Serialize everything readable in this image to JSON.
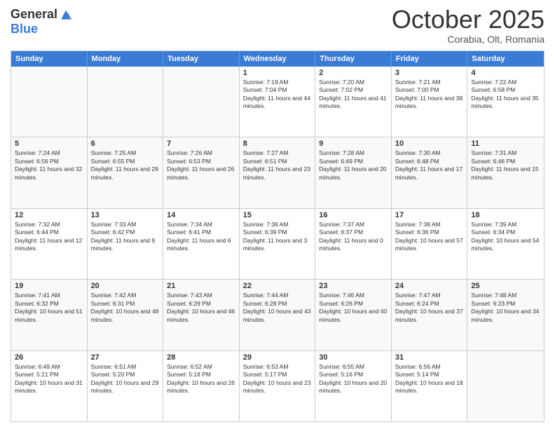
{
  "header": {
    "logo_general": "General",
    "logo_blue": "Blue",
    "month_title": "October 2025",
    "location": "Corabia, Olt, Romania"
  },
  "calendar": {
    "days_of_week": [
      "Sunday",
      "Monday",
      "Tuesday",
      "Wednesday",
      "Thursday",
      "Friday",
      "Saturday"
    ],
    "rows": [
      [
        {
          "day": "",
          "text": "",
          "empty": true
        },
        {
          "day": "",
          "text": "",
          "empty": true
        },
        {
          "day": "",
          "text": "",
          "empty": true
        },
        {
          "day": "1",
          "text": "Sunrise: 7:19 AM\nSunset: 7:04 PM\nDaylight: 11 hours and 44 minutes."
        },
        {
          "day": "2",
          "text": "Sunrise: 7:20 AM\nSunset: 7:02 PM\nDaylight: 11 hours and 41 minutes."
        },
        {
          "day": "3",
          "text": "Sunrise: 7:21 AM\nSunset: 7:00 PM\nDaylight: 11 hours and 38 minutes."
        },
        {
          "day": "4",
          "text": "Sunrise: 7:22 AM\nSunset: 6:58 PM\nDaylight: 11 hours and 35 minutes."
        }
      ],
      [
        {
          "day": "5",
          "text": "Sunrise: 7:24 AM\nSunset: 6:56 PM\nDaylight: 11 hours and 32 minutes."
        },
        {
          "day": "6",
          "text": "Sunrise: 7:25 AM\nSunset: 6:55 PM\nDaylight: 11 hours and 29 minutes."
        },
        {
          "day": "7",
          "text": "Sunrise: 7:26 AM\nSunset: 6:53 PM\nDaylight: 11 hours and 26 minutes."
        },
        {
          "day": "8",
          "text": "Sunrise: 7:27 AM\nSunset: 6:51 PM\nDaylight: 11 hours and 23 minutes."
        },
        {
          "day": "9",
          "text": "Sunrise: 7:28 AM\nSunset: 6:49 PM\nDaylight: 11 hours and 20 minutes."
        },
        {
          "day": "10",
          "text": "Sunrise: 7:30 AM\nSunset: 6:48 PM\nDaylight: 11 hours and 17 minutes."
        },
        {
          "day": "11",
          "text": "Sunrise: 7:31 AM\nSunset: 6:46 PM\nDaylight: 11 hours and 15 minutes."
        }
      ],
      [
        {
          "day": "12",
          "text": "Sunrise: 7:32 AM\nSunset: 6:44 PM\nDaylight: 11 hours and 12 minutes."
        },
        {
          "day": "13",
          "text": "Sunrise: 7:33 AM\nSunset: 6:42 PM\nDaylight: 11 hours and 9 minutes."
        },
        {
          "day": "14",
          "text": "Sunrise: 7:34 AM\nSunset: 6:41 PM\nDaylight: 11 hours and 6 minutes."
        },
        {
          "day": "15",
          "text": "Sunrise: 7:36 AM\nSunset: 6:39 PM\nDaylight: 11 hours and 3 minutes."
        },
        {
          "day": "16",
          "text": "Sunrise: 7:37 AM\nSunset: 6:37 PM\nDaylight: 11 hours and 0 minutes."
        },
        {
          "day": "17",
          "text": "Sunrise: 7:38 AM\nSunset: 6:36 PM\nDaylight: 10 hours and 57 minutes."
        },
        {
          "day": "18",
          "text": "Sunrise: 7:39 AM\nSunset: 6:34 PM\nDaylight: 10 hours and 54 minutes."
        }
      ],
      [
        {
          "day": "19",
          "text": "Sunrise: 7:41 AM\nSunset: 6:32 PM\nDaylight: 10 hours and 51 minutes."
        },
        {
          "day": "20",
          "text": "Sunrise: 7:42 AM\nSunset: 6:31 PM\nDaylight: 10 hours and 48 minutes."
        },
        {
          "day": "21",
          "text": "Sunrise: 7:43 AM\nSunset: 6:29 PM\nDaylight: 10 hours and 46 minutes."
        },
        {
          "day": "22",
          "text": "Sunrise: 7:44 AM\nSunset: 6:28 PM\nDaylight: 10 hours and 43 minutes."
        },
        {
          "day": "23",
          "text": "Sunrise: 7:46 AM\nSunset: 6:26 PM\nDaylight: 10 hours and 40 minutes."
        },
        {
          "day": "24",
          "text": "Sunrise: 7:47 AM\nSunset: 6:24 PM\nDaylight: 10 hours and 37 minutes."
        },
        {
          "day": "25",
          "text": "Sunrise: 7:48 AM\nSunset: 6:23 PM\nDaylight: 10 hours and 34 minutes."
        }
      ],
      [
        {
          "day": "26",
          "text": "Sunrise: 6:49 AM\nSunset: 5:21 PM\nDaylight: 10 hours and 31 minutes."
        },
        {
          "day": "27",
          "text": "Sunrise: 6:51 AM\nSunset: 5:20 PM\nDaylight: 10 hours and 29 minutes."
        },
        {
          "day": "28",
          "text": "Sunrise: 6:52 AM\nSunset: 5:18 PM\nDaylight: 10 hours and 26 minutes."
        },
        {
          "day": "29",
          "text": "Sunrise: 6:53 AM\nSunset: 5:17 PM\nDaylight: 10 hours and 23 minutes."
        },
        {
          "day": "30",
          "text": "Sunrise: 6:55 AM\nSunset: 5:16 PM\nDaylight: 10 hours and 20 minutes."
        },
        {
          "day": "31",
          "text": "Sunrise: 6:56 AM\nSunset: 5:14 PM\nDaylight: 10 hours and 18 minutes."
        },
        {
          "day": "",
          "text": "",
          "empty": true
        }
      ]
    ]
  }
}
